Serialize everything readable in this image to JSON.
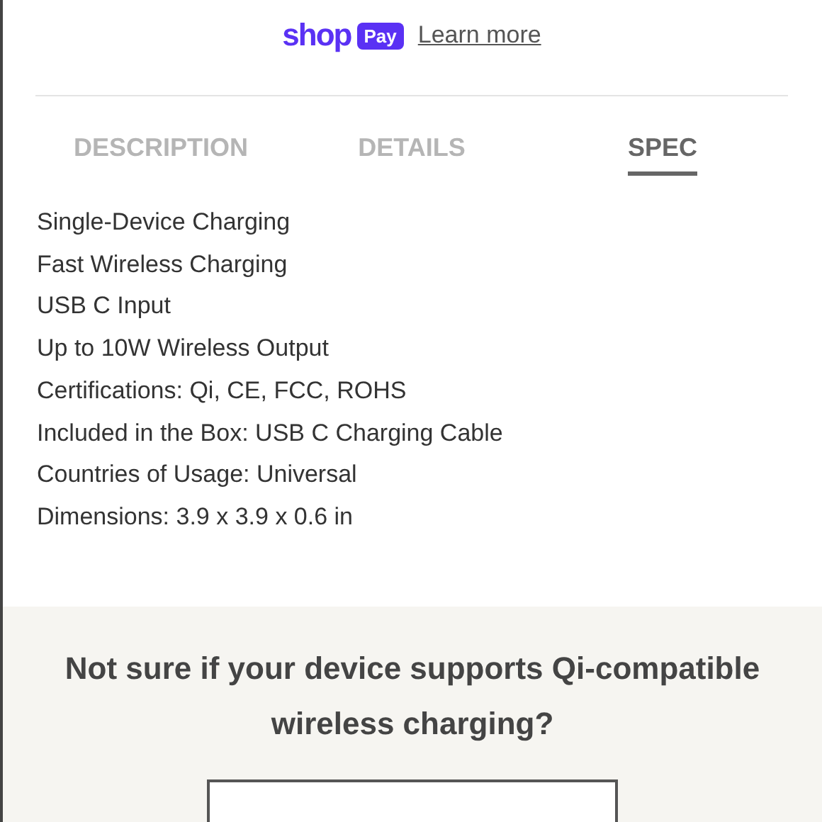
{
  "payment": {
    "logo_word": "shop",
    "logo_badge": "Pay",
    "link": "Learn more"
  },
  "tabs": [
    {
      "label": "DESCRIPTION",
      "selected": false
    },
    {
      "label": "DETAILS",
      "selected": false
    },
    {
      "label": "SPEC",
      "selected": true
    }
  ],
  "spec_lines": [
    "Single-Device Charging",
    "Fast Wireless Charging",
    "USB C Input",
    "Up to 10W Wireless Output",
    "Certifications: Qi, CE, FCC, ROHS",
    "Included in the Box: USB C Charging Cable",
    "Countries of Usage: Universal",
    "Dimensions: 3.9 x 3.9 x 0.6 in"
  ],
  "compatibility": {
    "heading": "Not sure if your device supports Qi-compatible wireless charging?"
  }
}
